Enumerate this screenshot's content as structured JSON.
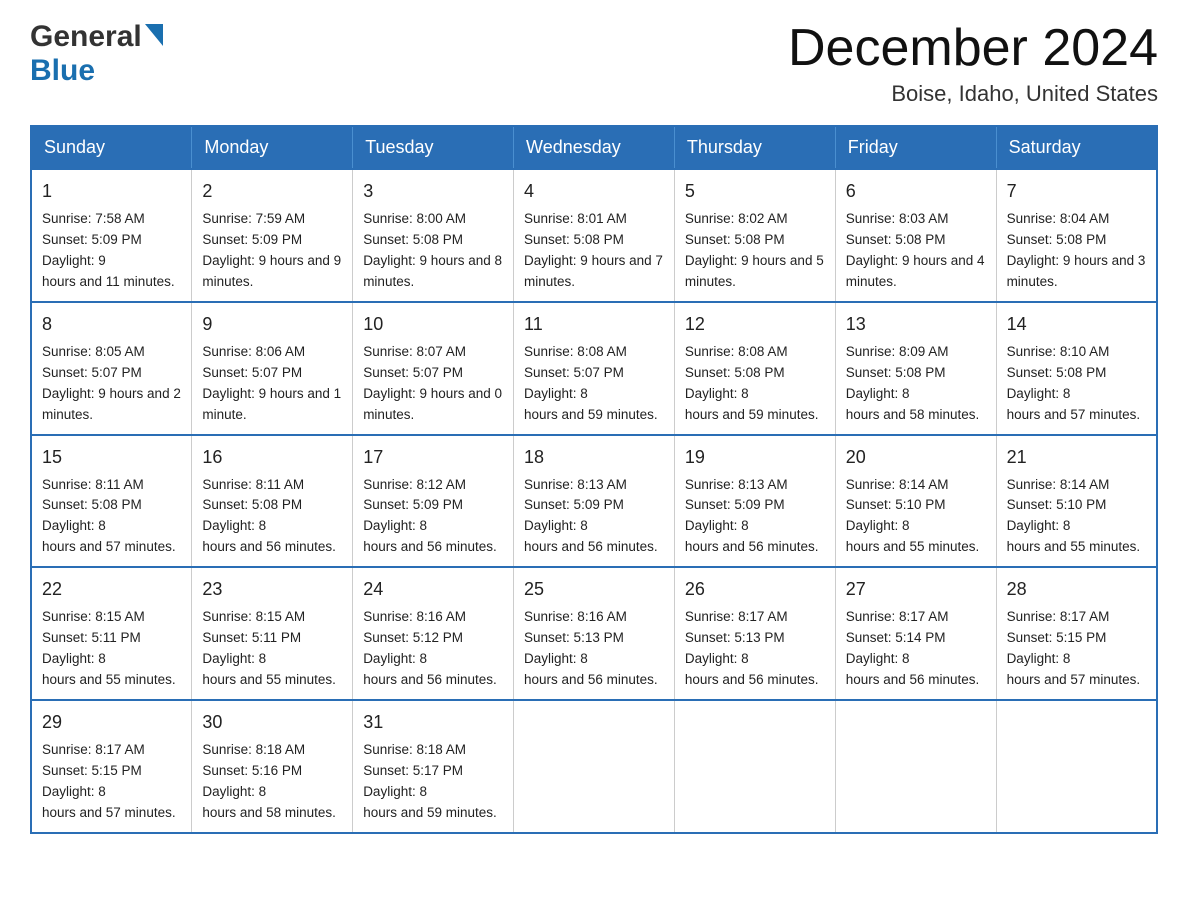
{
  "header": {
    "logo_general": "General",
    "logo_blue": "Blue",
    "title": "December 2024",
    "subtitle": "Boise, Idaho, United States"
  },
  "days_of_week": [
    "Sunday",
    "Monday",
    "Tuesday",
    "Wednesday",
    "Thursday",
    "Friday",
    "Saturday"
  ],
  "weeks": [
    [
      {
        "day": "1",
        "sunrise": "7:58 AM",
        "sunset": "5:09 PM",
        "daylight": "9 hours and 11 minutes."
      },
      {
        "day": "2",
        "sunrise": "7:59 AM",
        "sunset": "5:09 PM",
        "daylight": "9 hours and 9 minutes."
      },
      {
        "day": "3",
        "sunrise": "8:00 AM",
        "sunset": "5:08 PM",
        "daylight": "9 hours and 8 minutes."
      },
      {
        "day": "4",
        "sunrise": "8:01 AM",
        "sunset": "5:08 PM",
        "daylight": "9 hours and 7 minutes."
      },
      {
        "day": "5",
        "sunrise": "8:02 AM",
        "sunset": "5:08 PM",
        "daylight": "9 hours and 5 minutes."
      },
      {
        "day": "6",
        "sunrise": "8:03 AM",
        "sunset": "5:08 PM",
        "daylight": "9 hours and 4 minutes."
      },
      {
        "day": "7",
        "sunrise": "8:04 AM",
        "sunset": "5:08 PM",
        "daylight": "9 hours and 3 minutes."
      }
    ],
    [
      {
        "day": "8",
        "sunrise": "8:05 AM",
        "sunset": "5:07 PM",
        "daylight": "9 hours and 2 minutes."
      },
      {
        "day": "9",
        "sunrise": "8:06 AM",
        "sunset": "5:07 PM",
        "daylight": "9 hours and 1 minute."
      },
      {
        "day": "10",
        "sunrise": "8:07 AM",
        "sunset": "5:07 PM",
        "daylight": "9 hours and 0 minutes."
      },
      {
        "day": "11",
        "sunrise": "8:08 AM",
        "sunset": "5:07 PM",
        "daylight": "8 hours and 59 minutes."
      },
      {
        "day": "12",
        "sunrise": "8:08 AM",
        "sunset": "5:08 PM",
        "daylight": "8 hours and 59 minutes."
      },
      {
        "day": "13",
        "sunrise": "8:09 AM",
        "sunset": "5:08 PM",
        "daylight": "8 hours and 58 minutes."
      },
      {
        "day": "14",
        "sunrise": "8:10 AM",
        "sunset": "5:08 PM",
        "daylight": "8 hours and 57 minutes."
      }
    ],
    [
      {
        "day": "15",
        "sunrise": "8:11 AM",
        "sunset": "5:08 PM",
        "daylight": "8 hours and 57 minutes."
      },
      {
        "day": "16",
        "sunrise": "8:11 AM",
        "sunset": "5:08 PM",
        "daylight": "8 hours and 56 minutes."
      },
      {
        "day": "17",
        "sunrise": "8:12 AM",
        "sunset": "5:09 PM",
        "daylight": "8 hours and 56 minutes."
      },
      {
        "day": "18",
        "sunrise": "8:13 AM",
        "sunset": "5:09 PM",
        "daylight": "8 hours and 56 minutes."
      },
      {
        "day": "19",
        "sunrise": "8:13 AM",
        "sunset": "5:09 PM",
        "daylight": "8 hours and 56 minutes."
      },
      {
        "day": "20",
        "sunrise": "8:14 AM",
        "sunset": "5:10 PM",
        "daylight": "8 hours and 55 minutes."
      },
      {
        "day": "21",
        "sunrise": "8:14 AM",
        "sunset": "5:10 PM",
        "daylight": "8 hours and 55 minutes."
      }
    ],
    [
      {
        "day": "22",
        "sunrise": "8:15 AM",
        "sunset": "5:11 PM",
        "daylight": "8 hours and 55 minutes."
      },
      {
        "day": "23",
        "sunrise": "8:15 AM",
        "sunset": "5:11 PM",
        "daylight": "8 hours and 55 minutes."
      },
      {
        "day": "24",
        "sunrise": "8:16 AM",
        "sunset": "5:12 PM",
        "daylight": "8 hours and 56 minutes."
      },
      {
        "day": "25",
        "sunrise": "8:16 AM",
        "sunset": "5:13 PM",
        "daylight": "8 hours and 56 minutes."
      },
      {
        "day": "26",
        "sunrise": "8:17 AM",
        "sunset": "5:13 PM",
        "daylight": "8 hours and 56 minutes."
      },
      {
        "day": "27",
        "sunrise": "8:17 AM",
        "sunset": "5:14 PM",
        "daylight": "8 hours and 56 minutes."
      },
      {
        "day": "28",
        "sunrise": "8:17 AM",
        "sunset": "5:15 PM",
        "daylight": "8 hours and 57 minutes."
      }
    ],
    [
      {
        "day": "29",
        "sunrise": "8:17 AM",
        "sunset": "5:15 PM",
        "daylight": "8 hours and 57 minutes."
      },
      {
        "day": "30",
        "sunrise": "8:18 AM",
        "sunset": "5:16 PM",
        "daylight": "8 hours and 58 minutes."
      },
      {
        "day": "31",
        "sunrise": "8:18 AM",
        "sunset": "5:17 PM",
        "daylight": "8 hours and 59 minutes."
      },
      null,
      null,
      null,
      null
    ]
  ],
  "labels": {
    "sunrise": "Sunrise:",
    "sunset": "Sunset:",
    "daylight": "Daylight:"
  }
}
